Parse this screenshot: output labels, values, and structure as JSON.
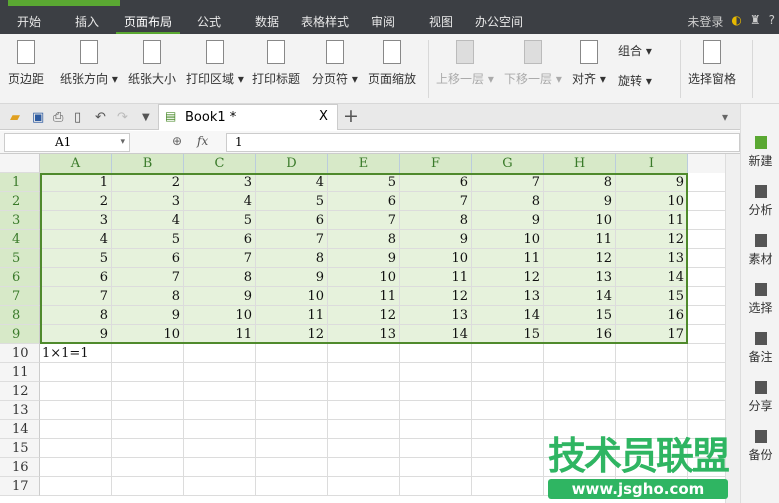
{
  "menu": {
    "items": [
      "开始",
      "插入",
      "页面布局",
      "公式",
      "数据",
      "表格样式",
      "审阅",
      "视图",
      "办公空间"
    ],
    "active": 2,
    "login": "未登录",
    "help": "?"
  },
  "ribbon": {
    "items": [
      {
        "label": "页边距",
        "icon": "margins-icon"
      },
      {
        "label": "纸张方向 ▾",
        "icon": "orientation-icon"
      },
      {
        "label": "纸张大小",
        "icon": "paper-size-icon"
      },
      {
        "label": "打印区域 ▾",
        "icon": "print-area-icon"
      },
      {
        "label": "打印标题",
        "icon": "print-titles-icon"
      },
      {
        "label": "分页符 ▾",
        "icon": "page-break-icon"
      },
      {
        "label": "页面缩放",
        "icon": "page-zoom-icon"
      },
      {
        "label": "上移一层 ▾",
        "icon": "bring-forward-icon",
        "disabled": true
      },
      {
        "label": "下移一层 ▾",
        "icon": "send-backward-icon",
        "disabled": true
      },
      {
        "label": "对齐 ▾",
        "icon": "align-icon"
      },
      {
        "label": "选择窗格",
        "icon": "selection-pane-icon"
      }
    ],
    "group": "组合 ▾",
    "rotate": "旋转 ▾"
  },
  "tabs": {
    "doc": "Book1 *",
    "close": "X",
    "add": "+"
  },
  "formula": {
    "namebox": "A1",
    "fx": "fx",
    "value": "1"
  },
  "sheet": {
    "columns": [
      "A",
      "B",
      "C",
      "D",
      "E",
      "F",
      "G",
      "H",
      "I"
    ],
    "rows": [
      [
        1,
        2,
        3,
        4,
        5,
        6,
        7,
        8,
        9
      ],
      [
        2,
        3,
        4,
        5,
        6,
        7,
        8,
        9,
        10
      ],
      [
        3,
        4,
        5,
        6,
        7,
        8,
        9,
        10,
        11
      ],
      [
        4,
        5,
        6,
        7,
        8,
        9,
        10,
        11,
        12
      ],
      [
        5,
        6,
        7,
        8,
        9,
        10,
        11,
        12,
        13
      ],
      [
        6,
        7,
        8,
        9,
        10,
        11,
        12,
        13,
        14
      ],
      [
        7,
        8,
        9,
        10,
        11,
        12,
        13,
        14,
        15
      ],
      [
        8,
        9,
        10,
        11,
        12,
        13,
        14,
        15,
        16
      ],
      [
        9,
        10,
        11,
        12,
        13,
        14,
        15,
        16,
        17
      ]
    ],
    "a10": "1×1=1",
    "row_count": 17
  },
  "sidebar": [
    "新建",
    "分析",
    "素材",
    "选择",
    "备注",
    "分享",
    "备份"
  ],
  "watermark": {
    "title": "技术员联盟",
    "url": "www.jsgho.com"
  },
  "colors": {
    "accent": "#5aa832",
    "selection": "#4f8a2c"
  }
}
